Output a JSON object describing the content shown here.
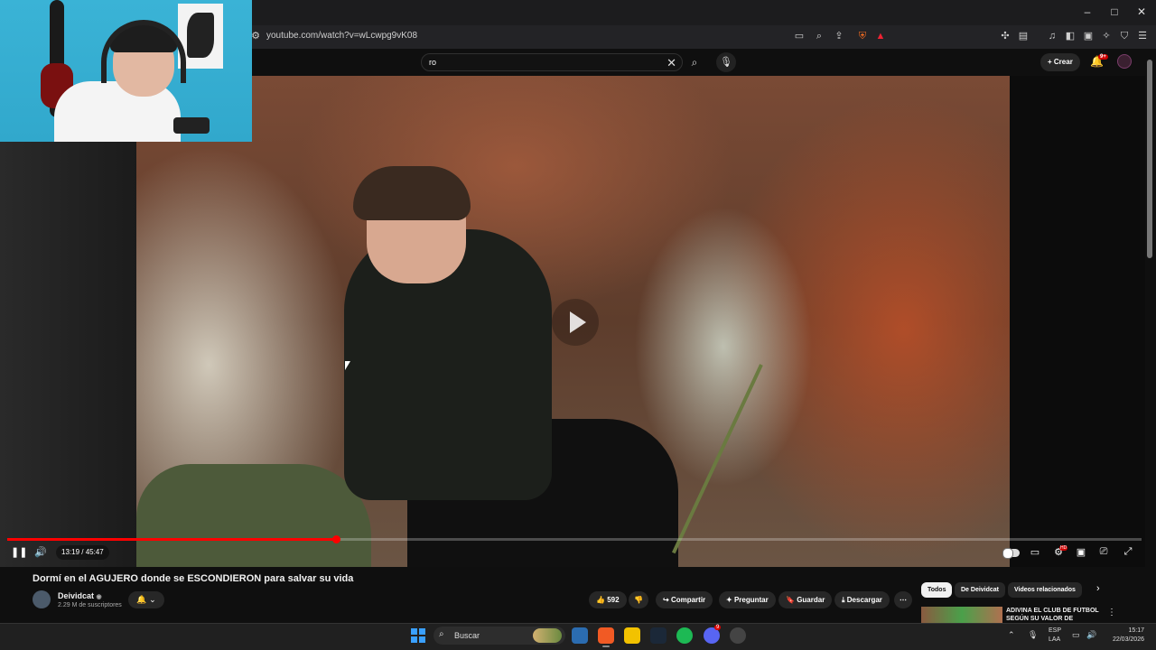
{
  "browser": {
    "url": "youtube.com/watch?v=wLcwpg9vK08",
    "window_controls": {
      "minimize": "–",
      "maximize": "□",
      "close": "✕"
    }
  },
  "header": {
    "search_value": "ro",
    "create_label": "Crear",
    "notif_count": "9+"
  },
  "player": {
    "time_display": "13:19 / 45:47",
    "progress": 0.29
  },
  "video": {
    "title": "Dormí en el AGUJERO donde se ESCONDIERON para salvar su vida",
    "channel_name": "Deividcat",
    "verified_mark": "◉",
    "subscribers": "2.29 M de suscriptores",
    "likes": "592",
    "share_label": "Compartir",
    "ask_label": "Preguntar",
    "save_label": "Guardar",
    "download_label": "Descargar"
  },
  "chips": [
    "Todos",
    "De Deividcat",
    "Videos relacionados"
  ],
  "recommended": {
    "title": "ADIVINA EL CLUB DE FÚTBOL SEGÚN SU VALOR DE"
  },
  "taskbar": {
    "search_label": "Buscar",
    "lang_1": "ESP",
    "lang_2": "LAA",
    "time": "15:17",
    "date": "22/03/2026",
    "discord_badge": "9"
  },
  "colors": {
    "progress": "#ff0000",
    "accent_blue": "#3aa0ff"
  }
}
